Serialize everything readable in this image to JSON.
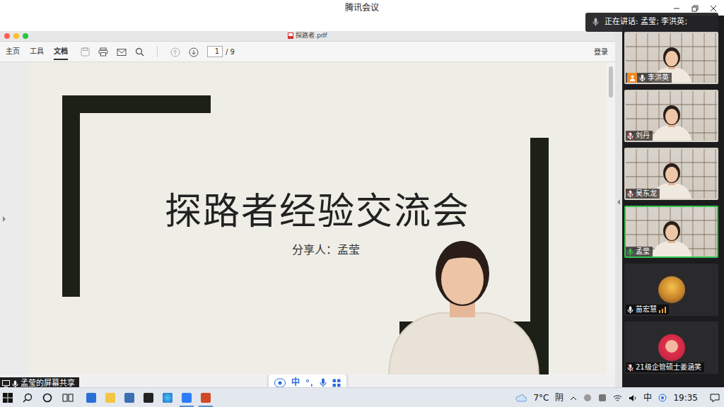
{
  "window": {
    "title": "腾讯会议"
  },
  "speaking": {
    "text": "正在讲话: 孟莹; 李洪英;"
  },
  "shared_app": {
    "title": "探路者.pdf",
    "menu": [
      {
        "label": "主页",
        "selected": false
      },
      {
        "label": "工具",
        "selected": false
      },
      {
        "label": "文档",
        "selected": true
      }
    ],
    "page_input": "1",
    "page_total": "/ 9",
    "login": "登录"
  },
  "document": {
    "title": "探路者经验交流会",
    "presenter": "分享人：孟莹"
  },
  "share_label": {
    "text": "孟莹的屏幕共享",
    "muted": false
  },
  "float_toolbar": {
    "ime": "中"
  },
  "participants": [
    {
      "name": "李洪英",
      "kind": "video",
      "host": true,
      "muted": false,
      "active": false,
      "audio_bars": false
    },
    {
      "name": "刘丹",
      "kind": "video",
      "host": false,
      "muted": true,
      "active": false,
      "audio_bars": false
    },
    {
      "name": "吴东龙",
      "kind": "video",
      "host": false,
      "muted": true,
      "active": false,
      "audio_bars": false
    },
    {
      "name": "孟莹",
      "kind": "video",
      "host": false,
      "muted": false,
      "active": true,
      "audio_bars": false
    },
    {
      "name": "苗宏慧",
      "kind": "avatar",
      "host": false,
      "muted": false,
      "active": false,
      "audio_bars": true
    },
    {
      "name": "21级企管硕士姜涵笑",
      "kind": "avatar",
      "host": false,
      "muted": true,
      "active": false,
      "audio_bars": false
    }
  ],
  "taskbar": {
    "temperature": "7°C",
    "weather": "阴",
    "ime": "中",
    "time": "19:35"
  }
}
